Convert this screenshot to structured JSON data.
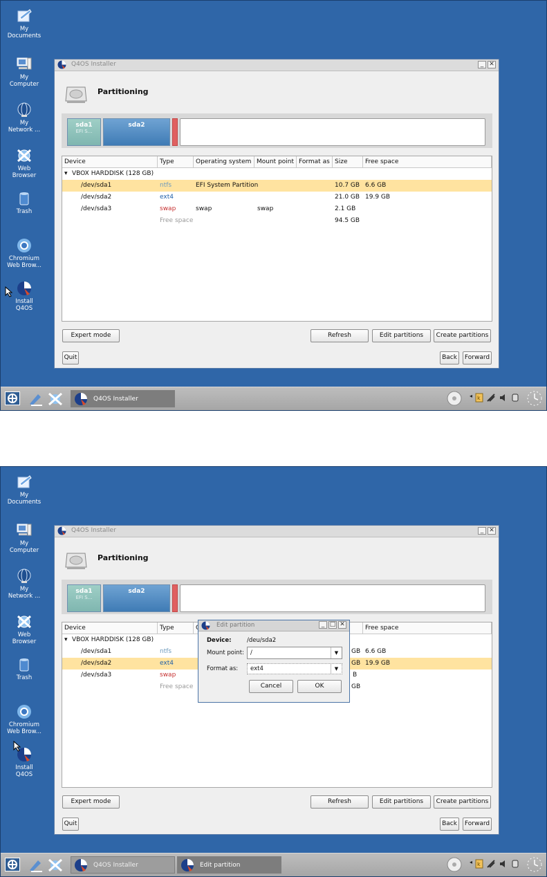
{
  "desktop": {
    "icons": [
      {
        "label": "My\nDocuments"
      },
      {
        "label": "My\nComputer"
      },
      {
        "label": "My\nNetwork ..."
      },
      {
        "label": "Web\nBrowser"
      },
      {
        "label": "Trash"
      },
      {
        "label": "Chromium\nWeb Brow..."
      },
      {
        "label": "Install\nQ4OS"
      }
    ]
  },
  "window": {
    "title": "Q4OS Installer",
    "header": "Partitioning",
    "partitions": [
      {
        "name": "sda1",
        "sub": "EFI S..."
      },
      {
        "name": "sda2",
        "sub": ""
      }
    ],
    "columns": [
      "Device",
      "Type",
      "Operating system",
      "Mount point",
      "Format as",
      "Size",
      "Free space"
    ],
    "disk": "VBOX HARDDISK (128 GB)",
    "rows": [
      {
        "device": "/dev/sda1",
        "type": "ntfs",
        "os": "EFI System Partition",
        "mount": "",
        "format": "",
        "size": "10.7 GB",
        "free": "6.6 GB"
      },
      {
        "device": "/dev/sda2",
        "type": "ext4",
        "os": "",
        "mount": "",
        "format": "",
        "size": "21.0 GB",
        "free": "19.9 GB"
      },
      {
        "device": "/dev/sda3",
        "type": "swap",
        "os": "swap",
        "mount": "swap",
        "format": "",
        "size": "2.1 GB",
        "free": ""
      },
      {
        "device": "",
        "type": "Free space",
        "os": "",
        "mount": "",
        "format": "",
        "size": "94.5 GB",
        "free": ""
      }
    ],
    "buttons": {
      "expert": "Expert mode",
      "refresh": "Refresh",
      "edit": "Edit partitions",
      "create": "Create partitions",
      "quit": "Quit",
      "back": "Back",
      "forward": "Forward"
    }
  },
  "dialog": {
    "title": "Edit partition",
    "device_label": "Device:",
    "device_value": "/deu/sda2",
    "mount_label": "Mount point:",
    "mount_value": "/",
    "format_label": "Format as:",
    "format_value": "ext4",
    "cancel": "Cancel",
    "ok": "OK"
  },
  "shot2_rows": [
    {
      "device": "/dev/sda1",
      "type": "ntfs",
      "size_tail": "GB",
      "free": "6.6 GB"
    },
    {
      "device": "/dev/sda2",
      "type": "ext4",
      "size_tail": "GB",
      "free": "19.9 GB"
    },
    {
      "device": "/dev/sda3",
      "type": "swap",
      "size_tail": "B",
      "free": ""
    },
    {
      "device": "",
      "type": "Free space",
      "size_tail": "GB",
      "free": ""
    }
  ],
  "taskbar": {
    "tasks": [
      {
        "label": "Q4OS Installer"
      },
      {
        "label": "Edit partition"
      }
    ]
  },
  "colors": {
    "desktop": "#2f66a8",
    "selection": "#ffe3a0",
    "ntfs": "#6e9bbd",
    "ext4": "#1f5fa8",
    "swap": "#c63030"
  }
}
